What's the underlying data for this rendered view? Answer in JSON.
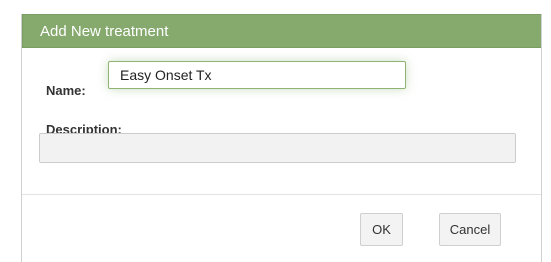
{
  "dialog": {
    "title": "Add New treatment",
    "name_label": "Name:",
    "name_value": "Easy Onset Tx",
    "description_label": "Description:",
    "description_value": "",
    "ok_label": "OK",
    "cancel_label": "Cancel"
  },
  "colors": {
    "titlebar": "#86a96e",
    "focus_border": "#8fb373"
  }
}
